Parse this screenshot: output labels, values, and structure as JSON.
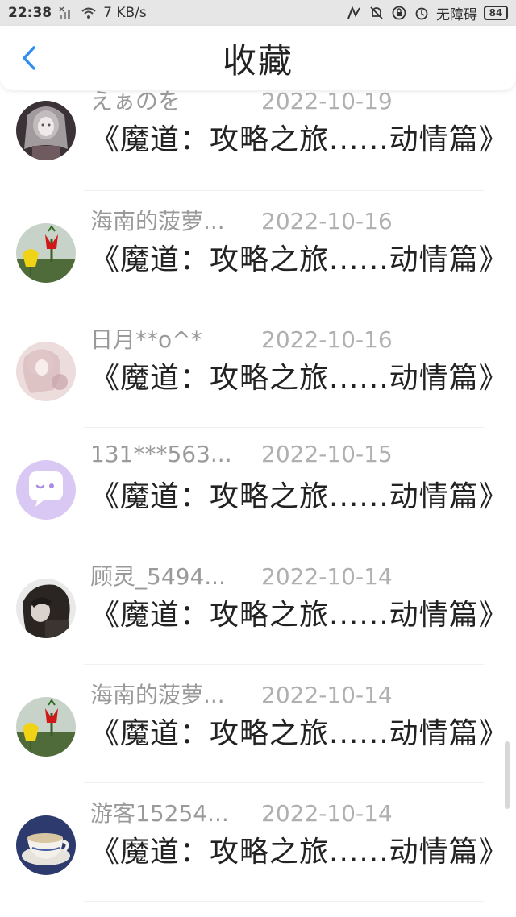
{
  "statusbar": {
    "time": "22:38",
    "network_speed": "7 KB/s",
    "mode_label": "无障碍",
    "battery": "84"
  },
  "header": {
    "title": "收藏"
  },
  "items": [
    {
      "username": "えぁのを",
      "date": "2022-10-19",
      "title": "《魔道：攻略之旅......动情篇》",
      "avatar": "portrait-gray"
    },
    {
      "username": "海南的菠萝...",
      "date": "2022-10-16",
      "title": "《魔道：攻略之旅......动情篇》",
      "avatar": "flowers"
    },
    {
      "username": "日月**o^*",
      "date": "2022-10-16",
      "title": "《魔道：攻略之旅......动情篇》",
      "avatar": "portrait-pink"
    },
    {
      "username": "131***563...",
      "date": "2022-10-15",
      "title": "《魔道：攻略之旅......动情篇》",
      "avatar": "chat-bubble"
    },
    {
      "username": "顾灵_5494...",
      "date": "2022-10-14",
      "title": "《魔道：攻略之旅......动情篇》",
      "avatar": "portrait-dark"
    },
    {
      "username": "海南的菠萝...",
      "date": "2022-10-14",
      "title": "《魔道：攻略之旅......动情篇》",
      "avatar": "flowers"
    },
    {
      "username": "游客15254...",
      "date": "2022-10-14",
      "title": "《魔道：攻略之旅......动情篇》",
      "avatar": "teacup"
    }
  ],
  "colors": {
    "accent": "#2f8ff0",
    "username": "#9a9a9a",
    "title": "#222222",
    "statusbar_bg": "#e6e6e6"
  }
}
